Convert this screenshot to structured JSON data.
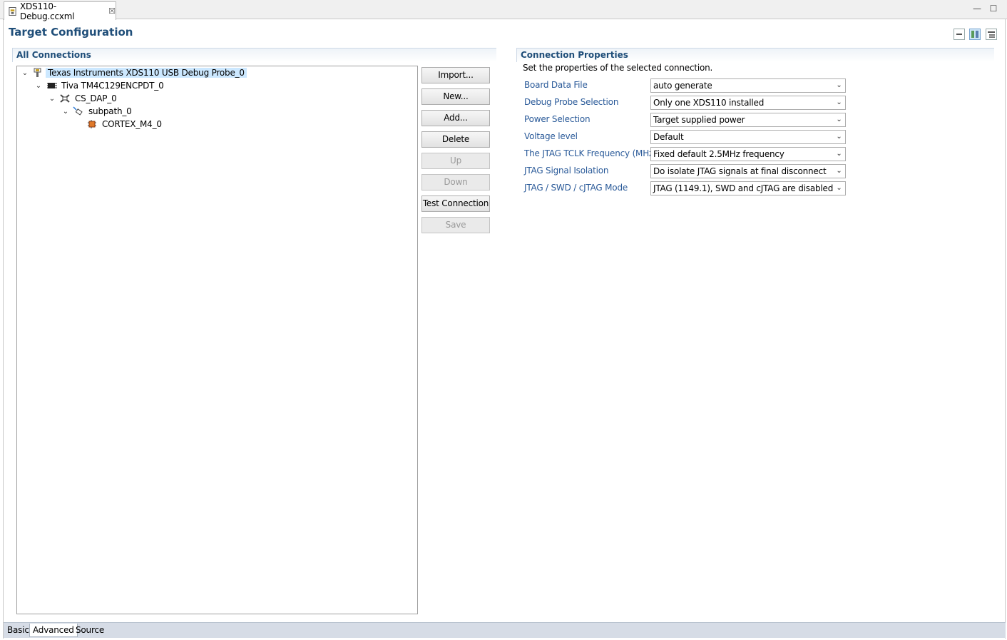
{
  "editor": {
    "tab_title": "XDS110-Debug.ccxml",
    "close_glyph": "☒"
  },
  "window": {
    "minimize_glyph": "—",
    "maximize_glyph": "☐"
  },
  "header": {
    "title": "Target Configuration"
  },
  "connections": {
    "title": "All Connections",
    "tree": [
      {
        "label": "Texas Instruments XDS110 USB Debug Probe_0",
        "icon": "probe-icon",
        "expanded": true,
        "selected": true
      },
      {
        "label": "Tiva TM4C129ENCPDT_0",
        "icon": "chip-icon",
        "expanded": true
      },
      {
        "label": "CS_DAP_0",
        "icon": "dap-icon",
        "expanded": true
      },
      {
        "label": "subpath_0",
        "icon": "subpath-icon",
        "expanded": true
      },
      {
        "label": "CORTEX_M4_0",
        "icon": "cpu-core-icon"
      }
    ],
    "buttons": {
      "import": "Import...",
      "new": "New...",
      "add": "Add...",
      "delete": "Delete",
      "up": "Up",
      "down": "Down",
      "test": "Test Connection",
      "save": "Save"
    }
  },
  "properties": {
    "title": "Connection Properties",
    "description": "Set the properties of the selected connection.",
    "rows": [
      {
        "label": "Board Data File",
        "value": "auto generate"
      },
      {
        "label": "Debug Probe Selection",
        "value": "Only one XDS110 installed"
      },
      {
        "label": "Power Selection",
        "value": "Target supplied power"
      },
      {
        "label": "Voltage level",
        "value": "Default"
      },
      {
        "label": "The JTAG TCLK Frequency (MHz)",
        "value": "Fixed default 2.5MHz frequency"
      },
      {
        "label": "JTAG Signal Isolation",
        "value": "Do isolate JTAG signals at final disconnect"
      },
      {
        "label": "JTAG / SWD / cJTAG Mode",
        "value": "JTAG (1149.1), SWD and cJTAG are disabled"
      }
    ]
  },
  "bottom_tabs": {
    "basic": "Basic",
    "advanced": "Advanced",
    "source": "Source"
  },
  "colors": {
    "accent": "#1f4e79",
    "label_blue": "#2a5a99",
    "selection": "#cce8ff"
  }
}
